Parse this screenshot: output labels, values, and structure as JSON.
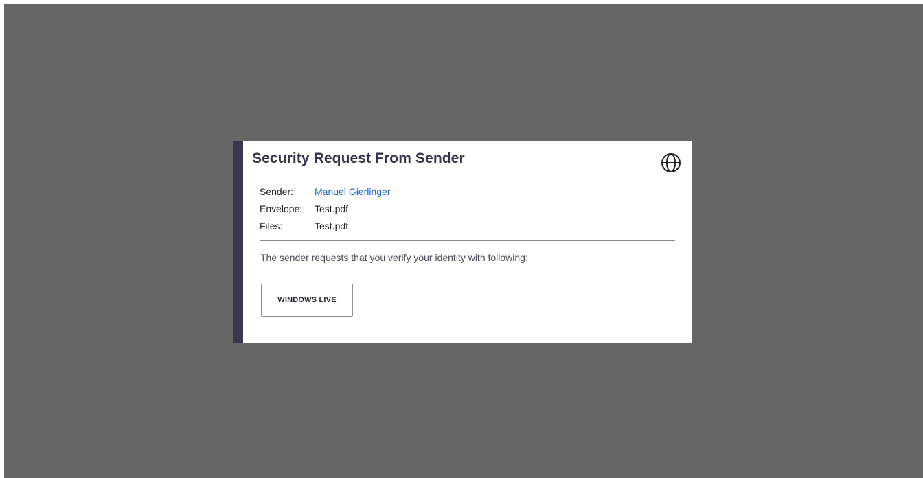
{
  "dialog": {
    "title": "Security Request From Sender",
    "language_icon": "globe-icon",
    "details": [
      {
        "label": "Sender:",
        "value": "Manuel Gierlinger",
        "is_link": true
      },
      {
        "label": "Envelope:",
        "value": "Test.pdf",
        "is_link": false
      },
      {
        "label": "Files:",
        "value": "Test.pdf",
        "is_link": false
      }
    ],
    "message": "The sender requests that you verify your identity with following:",
    "auth_button_label": "WINDOWS LIVE"
  },
  "colors": {
    "backdrop": "#666666",
    "accent_bar": "#373750",
    "link": "#1a66c9",
    "title": "#353549"
  }
}
